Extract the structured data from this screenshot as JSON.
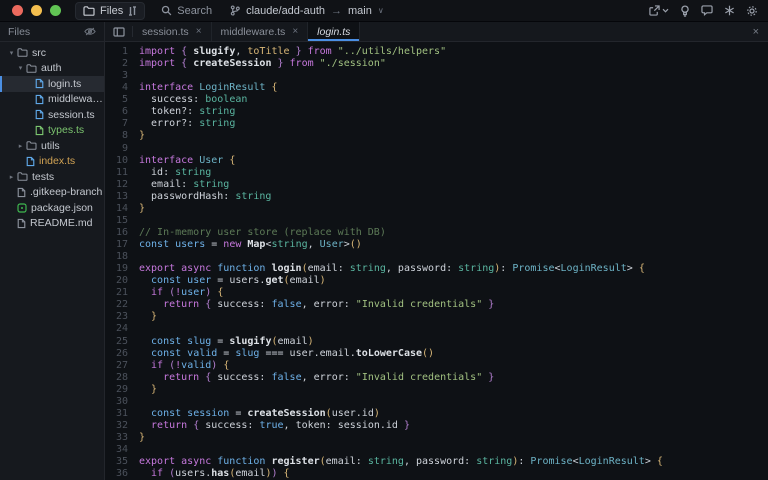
{
  "palette": {
    "bg_titlebar": "#101216",
    "bg_bar": "#15181d",
    "bg_sidebar": "#16191e",
    "bg_editor": "#0e1115",
    "border": "#23262c",
    "text": "#c9cdd4",
    "text_dim": "#9aa0ab",
    "gutter": "#4b515b",
    "accent": "#4b8fe3",
    "tl_red": "#ec6a5e",
    "tl_yellow": "#f4bf4f",
    "tl_green": "#61c554",
    "git_added": "#7cc56f",
    "git_modified": "#d2a354",
    "syn_keyword": "#c678dd",
    "syn_blue": "#6eb1e8",
    "syn_fn": "#dde1e6",
    "syn_text": "#ced3da",
    "syn_type": "#5ab5a0",
    "syn_type2": "#6db3c6",
    "syn_string": "#a1c181",
    "syn_comment": "#5d7a57",
    "syn_yellow": "#d9b777",
    "syn_purple": "#b37fd0"
  },
  "glyphs": {
    "arrow_right": "→",
    "chevron_down_small": "∨",
    "close": "×",
    "tree_expanded": "▾",
    "tree_collapsed": "▸"
  },
  "titlebar": {
    "project_button": "Files",
    "search_label": "Search",
    "branch_name": "claude/add-auth",
    "branch_target": "main"
  },
  "sidebar": {
    "header": "Files",
    "tree": [
      {
        "label": "src",
        "kind": "folder",
        "depth": 0,
        "expanded": true
      },
      {
        "label": "auth",
        "kind": "folder",
        "depth": 1,
        "expanded": true
      },
      {
        "label": "login.ts",
        "kind": "ts",
        "depth": 2,
        "selected": true
      },
      {
        "label": "middleware.ts",
        "kind": "ts",
        "depth": 2
      },
      {
        "label": "session.ts",
        "kind": "ts",
        "depth": 2
      },
      {
        "label": "types.ts",
        "kind": "ts",
        "depth": 2,
        "git": "added"
      },
      {
        "label": "utils",
        "kind": "folder",
        "depth": 1,
        "expanded": false
      },
      {
        "label": "index.ts",
        "kind": "ts",
        "depth": 1,
        "git": "modified"
      },
      {
        "label": "tests",
        "kind": "folder",
        "depth": 0,
        "expanded": false
      },
      {
        "label": ".gitkeep-branch",
        "kind": "file",
        "depth": 0
      },
      {
        "label": "package.json",
        "kind": "json",
        "depth": 0
      },
      {
        "label": "README.md",
        "kind": "file",
        "depth": 0
      }
    ]
  },
  "tabbar": {
    "tabs": [
      {
        "label": "session.ts",
        "active": false,
        "closable": true,
        "preview": false
      },
      {
        "label": "middleware.ts",
        "active": false,
        "closable": true,
        "preview": false
      },
      {
        "label": "login.ts",
        "active": true,
        "closable": false,
        "preview": true
      }
    ]
  },
  "editor": {
    "language": "TypeScript",
    "lines": [
      {
        "n": 1,
        "tokens": [
          [
            "k",
            "import"
          ],
          [
            "pu",
            " {"
          ],
          [
            "f",
            " slugify"
          ],
          [
            "w",
            ","
          ],
          [
            "y",
            " toTitle"
          ],
          [
            "pu",
            " }"
          ],
          [
            "k",
            " from"
          ],
          [
            "s",
            " \"../utils/helpers\""
          ]
        ]
      },
      {
        "n": 2,
        "tokens": [
          [
            "k",
            "import"
          ],
          [
            "pu",
            " {"
          ],
          [
            "f",
            " createSession"
          ],
          [
            "pu",
            " }"
          ],
          [
            "k",
            " from"
          ],
          [
            "s",
            " \"./session\""
          ]
        ]
      },
      {
        "n": 3,
        "tokens": []
      },
      {
        "n": 4,
        "tokens": [
          [
            "k",
            "interface"
          ],
          [
            "tc",
            " LoginResult"
          ],
          [
            "y",
            " {"
          ]
        ]
      },
      {
        "n": 5,
        "tokens": [
          [
            "w",
            "  success: "
          ],
          [
            "tp",
            "boolean"
          ]
        ]
      },
      {
        "n": 6,
        "tokens": [
          [
            "w",
            "  token?: "
          ],
          [
            "tp",
            "string"
          ]
        ]
      },
      {
        "n": 7,
        "tokens": [
          [
            "w",
            "  error?: "
          ],
          [
            "tp",
            "string"
          ]
        ]
      },
      {
        "n": 8,
        "tokens": [
          [
            "y",
            "}"
          ]
        ]
      },
      {
        "n": 9,
        "tokens": []
      },
      {
        "n": 10,
        "tokens": [
          [
            "k",
            "interface"
          ],
          [
            "tc",
            " User"
          ],
          [
            "y",
            " {"
          ]
        ]
      },
      {
        "n": 11,
        "tokens": [
          [
            "w",
            "  id: "
          ],
          [
            "tp",
            "string"
          ]
        ]
      },
      {
        "n": 12,
        "tokens": [
          [
            "w",
            "  email: "
          ],
          [
            "tp",
            "string"
          ]
        ]
      },
      {
        "n": 13,
        "tokens": [
          [
            "w",
            "  passwordHash: "
          ],
          [
            "tp",
            "string"
          ]
        ]
      },
      {
        "n": 14,
        "tokens": [
          [
            "y",
            "}"
          ]
        ]
      },
      {
        "n": 15,
        "tokens": []
      },
      {
        "n": 16,
        "tokens": [
          [
            "c",
            "// In-memory user store (replace with DB)"
          ]
        ]
      },
      {
        "n": 17,
        "tokens": [
          [
            "b",
            "const"
          ],
          [
            "b",
            " users"
          ],
          [
            "w",
            " = "
          ],
          [
            "k",
            "new"
          ],
          [
            "f",
            " Map"
          ],
          [
            "w",
            "<"
          ],
          [
            "tp",
            "string"
          ],
          [
            "w",
            ", "
          ],
          [
            "tc",
            "User"
          ],
          [
            "w",
            ">"
          ],
          [
            "y",
            "()"
          ]
        ]
      },
      {
        "n": 18,
        "tokens": []
      },
      {
        "n": 19,
        "tokens": [
          [
            "k",
            "export"
          ],
          [
            "k",
            " async"
          ],
          [
            "b",
            " function"
          ],
          [
            "f",
            " login"
          ],
          [
            "y",
            "("
          ],
          [
            "w",
            "email: "
          ],
          [
            "tp",
            "string"
          ],
          [
            "w",
            ", "
          ],
          [
            "w",
            "password: "
          ],
          [
            "tp",
            "string"
          ],
          [
            "y",
            ")"
          ],
          [
            "w",
            ": "
          ],
          [
            "tc",
            "Promise"
          ],
          [
            "w",
            "<"
          ],
          [
            "tc",
            "LoginResult"
          ],
          [
            "w",
            ">"
          ],
          [
            "y",
            " {"
          ]
        ]
      },
      {
        "n": 20,
        "tokens": [
          [
            "b",
            "  const"
          ],
          [
            "b",
            " user"
          ],
          [
            "w",
            " = "
          ],
          [
            "w",
            "users."
          ],
          [
            "f",
            "get"
          ],
          [
            "y",
            "("
          ],
          [
            "w",
            "email"
          ],
          [
            "y",
            ")"
          ]
        ]
      },
      {
        "n": 21,
        "tokens": [
          [
            "k",
            "  if"
          ],
          [
            "pu",
            " ("
          ],
          [
            "k",
            "!"
          ],
          [
            "b",
            "user"
          ],
          [
            "pu",
            ")"
          ],
          [
            "y",
            " {"
          ]
        ]
      },
      {
        "n": 22,
        "tokens": [
          [
            "k",
            "    return"
          ],
          [
            "pu",
            " {"
          ],
          [
            "w",
            " success: "
          ],
          [
            "b",
            "false"
          ],
          [
            "w",
            ", "
          ],
          [
            "w",
            "error: "
          ],
          [
            "s",
            "\"Invalid credentials\""
          ],
          [
            "pu",
            " }"
          ]
        ]
      },
      {
        "n": 23,
        "tokens": [
          [
            "y",
            "  }"
          ]
        ]
      },
      {
        "n": 24,
        "tokens": []
      },
      {
        "n": 25,
        "tokens": [
          [
            "b",
            "  const"
          ],
          [
            "b",
            " slug"
          ],
          [
            "w",
            " = "
          ],
          [
            "f",
            "slugify"
          ],
          [
            "y",
            "("
          ],
          [
            "w",
            "email"
          ],
          [
            "y",
            ")"
          ]
        ]
      },
      {
        "n": 26,
        "tokens": [
          [
            "b",
            "  const"
          ],
          [
            "b",
            " valid"
          ],
          [
            "w",
            " = "
          ],
          [
            "b",
            "slug"
          ],
          [
            "w",
            " === "
          ],
          [
            "w",
            "user.email."
          ],
          [
            "f",
            "toLowerCase"
          ],
          [
            "y",
            "()"
          ]
        ]
      },
      {
        "n": 27,
        "tokens": [
          [
            "k",
            "  if"
          ],
          [
            "pu",
            " ("
          ],
          [
            "k",
            "!"
          ],
          [
            "b",
            "valid"
          ],
          [
            "pu",
            ")"
          ],
          [
            "y",
            " {"
          ]
        ]
      },
      {
        "n": 28,
        "tokens": [
          [
            "k",
            "    return"
          ],
          [
            "pu",
            " {"
          ],
          [
            "w",
            " success: "
          ],
          [
            "b",
            "false"
          ],
          [
            "w",
            ", "
          ],
          [
            "w",
            "error: "
          ],
          [
            "s",
            "\"Invalid credentials\""
          ],
          [
            "pu",
            " }"
          ]
        ]
      },
      {
        "n": 29,
        "tokens": [
          [
            "y",
            "  }"
          ]
        ]
      },
      {
        "n": 30,
        "tokens": []
      },
      {
        "n": 31,
        "tokens": [
          [
            "b",
            "  const"
          ],
          [
            "b",
            " session"
          ],
          [
            "w",
            " = "
          ],
          [
            "f",
            "createSession"
          ],
          [
            "y",
            "("
          ],
          [
            "w",
            "user.id"
          ],
          [
            "y",
            ")"
          ]
        ]
      },
      {
        "n": 32,
        "tokens": [
          [
            "k",
            "  return"
          ],
          [
            "pu",
            " {"
          ],
          [
            "w",
            " success: "
          ],
          [
            "b",
            "true"
          ],
          [
            "w",
            ", "
          ],
          [
            "w",
            "token: "
          ],
          [
            "w",
            "session.id"
          ],
          [
            "pu",
            " }"
          ]
        ]
      },
      {
        "n": 33,
        "tokens": [
          [
            "y",
            "}"
          ]
        ]
      },
      {
        "n": 34,
        "tokens": []
      },
      {
        "n": 35,
        "tokens": [
          [
            "k",
            "export"
          ],
          [
            "k",
            " async"
          ],
          [
            "b",
            " function"
          ],
          [
            "f",
            " register"
          ],
          [
            "y",
            "("
          ],
          [
            "w",
            "email: "
          ],
          [
            "tp",
            "string"
          ],
          [
            "w",
            ", "
          ],
          [
            "w",
            "password: "
          ],
          [
            "tp",
            "string"
          ],
          [
            "y",
            ")"
          ],
          [
            "w",
            ": "
          ],
          [
            "tc",
            "Promise"
          ],
          [
            "w",
            "<"
          ],
          [
            "tc",
            "LoginResult"
          ],
          [
            "w",
            ">"
          ],
          [
            "y",
            " {"
          ]
        ]
      },
      {
        "n": 36,
        "tokens": [
          [
            "k",
            "  if"
          ],
          [
            "pu",
            " ("
          ],
          [
            "w",
            "users."
          ],
          [
            "f",
            "has"
          ],
          [
            "y",
            "("
          ],
          [
            "w",
            "email"
          ],
          [
            "y",
            ")"
          ],
          [
            "pu",
            ")"
          ],
          [
            "y",
            " {"
          ]
        ]
      }
    ]
  }
}
